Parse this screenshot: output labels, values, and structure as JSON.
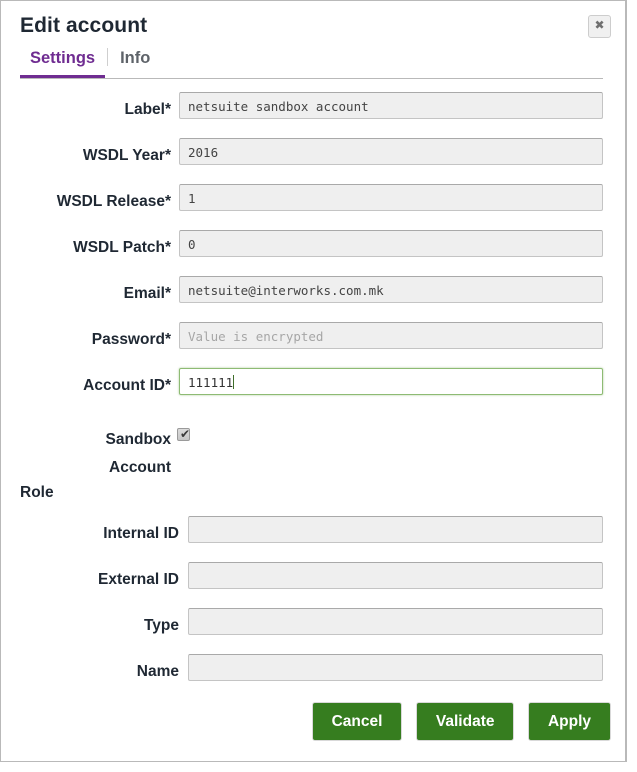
{
  "dialog": {
    "title": "Edit account",
    "close_icon": "close-icon",
    "close_glyph": "✖"
  },
  "tabs": [
    {
      "label": "Settings",
      "active": true
    },
    {
      "label": "Info",
      "active": false
    }
  ],
  "form": {
    "fields": [
      {
        "label": "Label*",
        "value": "netsuite sandbox account",
        "placeholder": "",
        "focused": false
      },
      {
        "label": "WSDL Year*",
        "value": "2016",
        "placeholder": "",
        "focused": false
      },
      {
        "label": "WSDL Release*",
        "value": "1",
        "placeholder": "",
        "focused": false
      },
      {
        "label": "WSDL Patch*",
        "value": "0",
        "placeholder": "",
        "focused": false
      },
      {
        "label": "Email*",
        "value": "netsuite@interworks.com.mk",
        "placeholder": "",
        "focused": false
      },
      {
        "label": "Password*",
        "value": "",
        "placeholder": "Value is encrypted",
        "focused": false
      },
      {
        "label": "Account ID*",
        "value": "111111",
        "placeholder": "",
        "focused": true
      }
    ],
    "checkbox": {
      "label_line1": "Sandbox",
      "label_line2": "Account",
      "checked": true,
      "check_glyph": "✔"
    },
    "section": {
      "title": "Role",
      "fields": [
        {
          "label": "Internal ID",
          "value": "",
          "placeholder": ""
        },
        {
          "label": "External ID",
          "value": "",
          "placeholder": ""
        },
        {
          "label": "Type",
          "value": "",
          "placeholder": ""
        },
        {
          "label": "Name",
          "value": "",
          "placeholder": ""
        }
      ]
    }
  },
  "footer": {
    "buttons": [
      {
        "label": "Cancel"
      },
      {
        "label": "Validate"
      },
      {
        "label": "Apply"
      }
    ]
  },
  "colors": {
    "accent_tab": "#6f2c91",
    "button_green": "#367d1f",
    "focus_border": "#8ebb74",
    "field_bg": "#efefef"
  }
}
